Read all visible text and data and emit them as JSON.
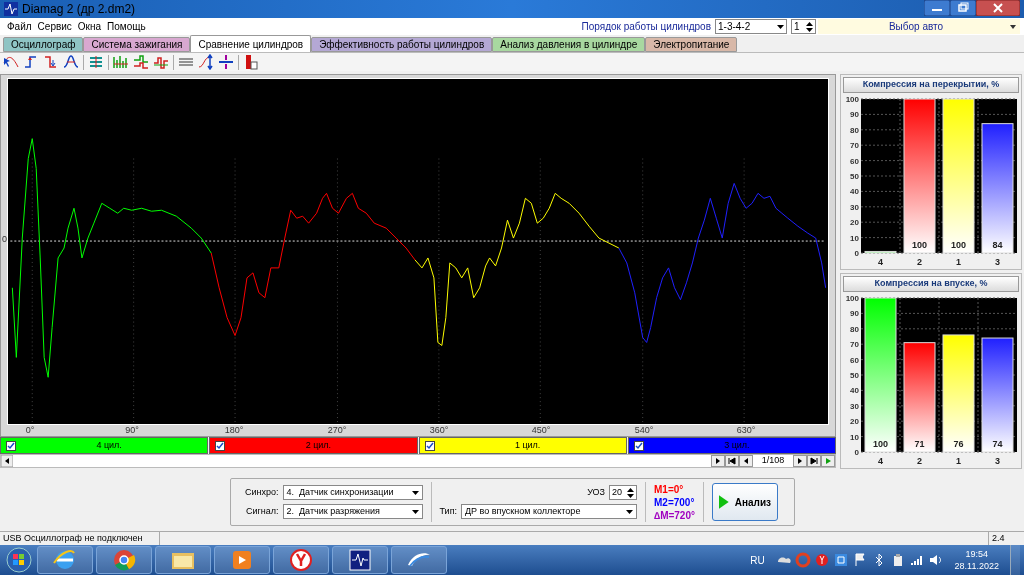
{
  "window": {
    "title": "Diamag 2 (др 2.dm2)"
  },
  "menu": [
    "Файл",
    "Сервис",
    "Окна",
    "Помощь"
  ],
  "firing_order": {
    "label": "Порядок работы цилиндров",
    "value": "1-3-4-2",
    "spin": "1"
  },
  "car_select": {
    "value": "Выбор авто"
  },
  "tabs": [
    {
      "label": "Осциллограф",
      "selected": false,
      "color": "#8fc4c4"
    },
    {
      "label": "Система зажигания",
      "selected": false,
      "color": "#d8a8d0"
    },
    {
      "label": "Сравнение цилиндров",
      "selected": true,
      "color": "#ffffff"
    },
    {
      "label": "Эффективность работы цилиндров",
      "selected": false,
      "color": "#b4a8d4"
    },
    {
      "label": "Анализ давления в цилиндре",
      "selected": false,
      "color": "#a8d8a0"
    },
    {
      "label": "Электропитание",
      "selected": false,
      "color": "#d8b8a8"
    }
  ],
  "scope": {
    "y_label": "0",
    "x_ticks": [
      "0°",
      "90°",
      "180°",
      "270°",
      "360°",
      "450°",
      "540°",
      "630°"
    ],
    "cylinders": [
      {
        "label": "4 цил.",
        "checked": true,
        "color": "#00ff00"
      },
      {
        "label": "2 цил.",
        "checked": true,
        "color": "#ff0000"
      },
      {
        "label": "1 цил.",
        "checked": true,
        "color": "#ffff00"
      },
      {
        "label": "3 цил.",
        "checked": true,
        "color": "#0000ff"
      }
    ],
    "page": "1/108"
  },
  "analysis": {
    "sync_label": "Синхро:",
    "sync_value": "4.  Датчик синхронизации",
    "signal_label": "Сигнал:",
    "signal_value": "2.  Датчик разряжения",
    "uoz_label": "УОЗ",
    "uoz_value": "20",
    "type_label": "Тип:",
    "type_value": "ДР во впускном коллекторе",
    "markers": [
      {
        "text": "M1=0°",
        "color": "#ff0000"
      },
      {
        "text": "M2=700°",
        "color": "#0000ff"
      },
      {
        "text": "∆M=720°",
        "color": "#a000c0"
      }
    ],
    "button": "Анализ"
  },
  "charts": [
    {
      "title": "Компрессия на перекрытии, %",
      "chart_data": {
        "type": "bar",
        "categories": [
          "4",
          "2",
          "1",
          "3"
        ],
        "series": [
          {
            "values": [
              1,
              100,
              100,
              84
            ]
          }
        ],
        "grid": true,
        "ylim": [
          0,
          100
        ],
        "yticks": [
          0,
          10,
          20,
          30,
          40,
          50,
          60,
          70,
          80,
          90,
          100
        ],
        "value_labels": [
          null,
          "100",
          "100",
          "84"
        ]
      }
    },
    {
      "title": "Компрессия на впуске, %",
      "chart_data": {
        "type": "bar",
        "categories": [
          "4",
          "2",
          "1",
          "3"
        ],
        "series": [
          {
            "values": [
              100,
              71,
              76,
              74
            ]
          }
        ],
        "grid": true,
        "ylim": [
          0,
          100
        ],
        "yticks": [
          0,
          10,
          20,
          30,
          40,
          50,
          60,
          70,
          80,
          90,
          100
        ],
        "data_labels": true
      }
    }
  ],
  "status_bar": {
    "message": "USB Осциллограф не подключен",
    "version": "2.4"
  },
  "taskbar": {
    "language": "RU",
    "time": "19:54",
    "date": "28.11.2022"
  }
}
